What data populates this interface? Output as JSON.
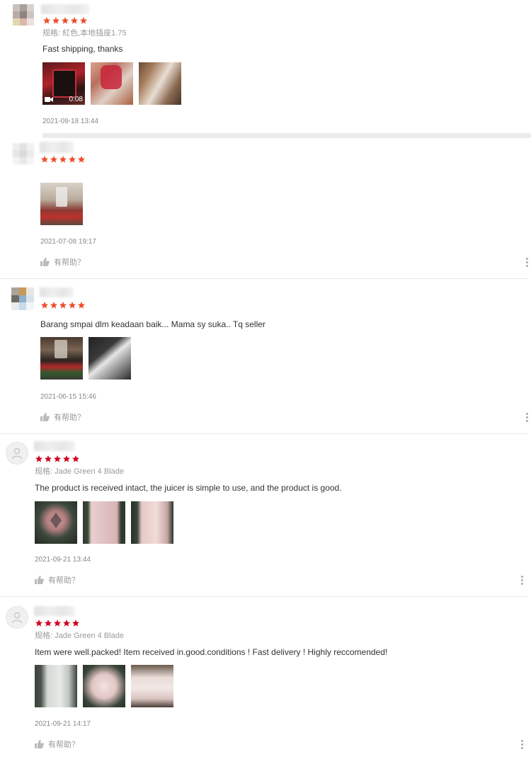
{
  "colors": {
    "star_orange": "#ee4d2d",
    "star_red": "#d0011b",
    "divider": "#e8e8e8"
  },
  "reviews": [
    {
      "stars": 5,
      "spec": "规格: 紅色,本地插座1.75",
      "comment": "Fast shipping, thanks",
      "video_duration": "0:08",
      "date": "2021-09-18 13:44"
    },
    {
      "stars": 5,
      "date": "2021-07-08 19:17",
      "helpful_label": "有帮助？"
    },
    {
      "stars": 5,
      "comment": "Barang smpai dlm keadaan baik... Mama sy suka.. Tq seller",
      "date": "2021-06-15 15:46",
      "helpful_label": "有帮助？"
    },
    {
      "stars": 5,
      "spec": "规格: Jade Green 4 Blade",
      "comment": "The product is received intact, the juicer is simple to use, and the product is good.",
      "date": "2021-09-21 13:44",
      "helpful_label": "有帮助？"
    },
    {
      "stars": 5,
      "spec": "规格: Jade Green 4 Blade",
      "comment": "Item were well.packed! Item received in.good.conditions ! Fast delivery ! Highly reccomended!",
      "date": "2021-09-21 14:17",
      "helpful_label": "有帮助？"
    }
  ]
}
